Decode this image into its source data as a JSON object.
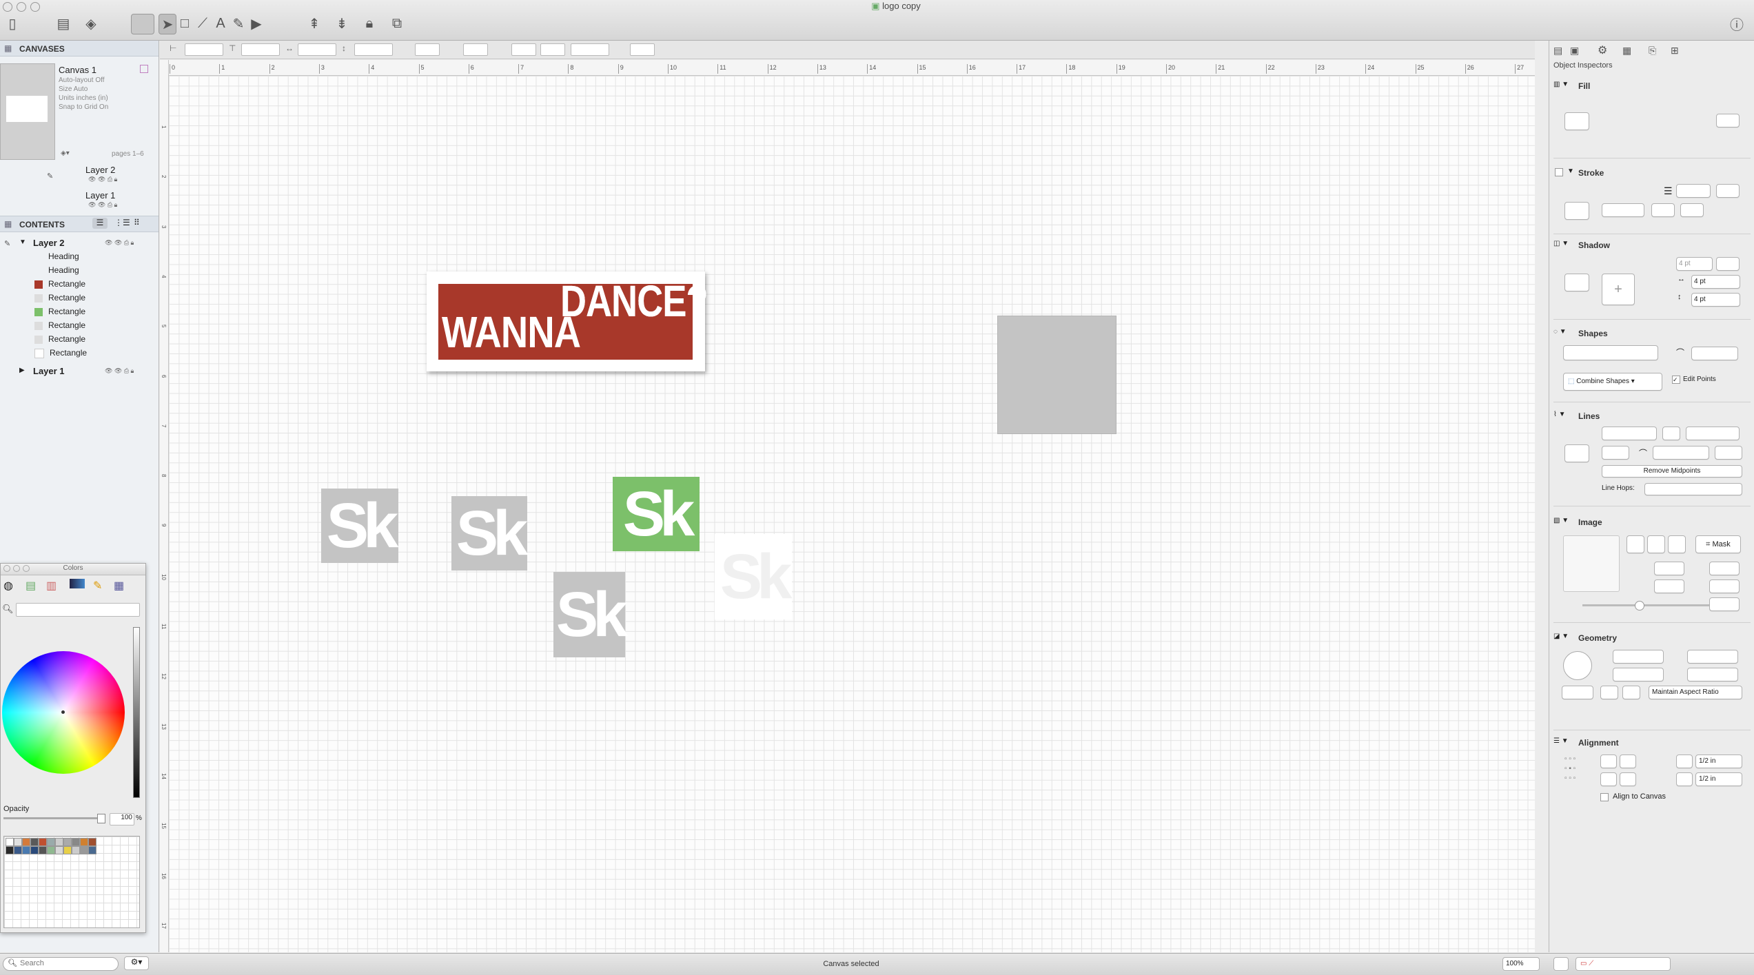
{
  "window": {
    "title": "logo copy"
  },
  "sidebar": {
    "canvases_header": "CANVASES",
    "canvas": {
      "name": "Canvas 1",
      "autolayout": "Auto-layout Off",
      "size": "Size Auto",
      "units": "Units inches (in)",
      "snap": "Snap to Grid On",
      "pages": "pages 1–6"
    },
    "layers": [
      "Layer 2",
      "Layer 1"
    ],
    "contents_header": "CONTENTS",
    "tree": {
      "layer2": "Layer 2",
      "items": [
        "Heading",
        "Heading",
        "Rectangle",
        "Rectangle",
        "Rectangle",
        "Rectangle",
        "Rectangle",
        "Rectangle"
      ],
      "layer1": "Layer 1"
    }
  },
  "colors_panel": {
    "title": "Colors",
    "opacity_label": "Opacity",
    "opacity_value": "100",
    "opacity_unit": "%"
  },
  "artwork": {
    "wanna": "WANNA",
    "dance": "DANCE?",
    "sk": "Sk"
  },
  "ruler": {
    "ticks": [
      "0",
      "1",
      "2",
      "3",
      "4",
      "5",
      "6",
      "7",
      "8",
      "9",
      "10",
      "11",
      "12",
      "13",
      "14",
      "15",
      "16",
      "17",
      "18",
      "19",
      "20",
      "21",
      "22",
      "23",
      "24",
      "25",
      "26",
      "27"
    ],
    "vticks": [
      "1",
      "2",
      "3",
      "4",
      "5",
      "6",
      "7",
      "8",
      "9",
      "10",
      "11",
      "12",
      "13",
      "14",
      "15",
      "16",
      "17"
    ]
  },
  "inspector": {
    "header": "Object Inspectors",
    "fill": "Fill",
    "stroke": "Stroke",
    "shadow": "Shadow",
    "shadow_size": "4 pt",
    "shadow_x": "4 pt",
    "shadow_y": "4 pt",
    "shapes": "Shapes",
    "combine": "Combine Shapes",
    "edit_points": "Edit Points",
    "lines": "Lines",
    "remove_midpoints": "Remove Midpoints",
    "line_hops": "Line Hops:",
    "image": "Image",
    "mask": "Mask",
    "geometry": "Geometry",
    "aspect": "Maintain Aspect Ratio",
    "alignment": "Alignment",
    "align_h": "1/2 in",
    "align_v": "1/2 in",
    "align_canvas": "Align to Canvas"
  },
  "status": {
    "search_placeholder": "Search",
    "message": "Canvas selected",
    "zoom": "100%"
  },
  "colors": {
    "red": "#a8382a",
    "green": "#7cc06a",
    "gray": "#c4c4c4",
    "accent": "#3b78d8"
  }
}
